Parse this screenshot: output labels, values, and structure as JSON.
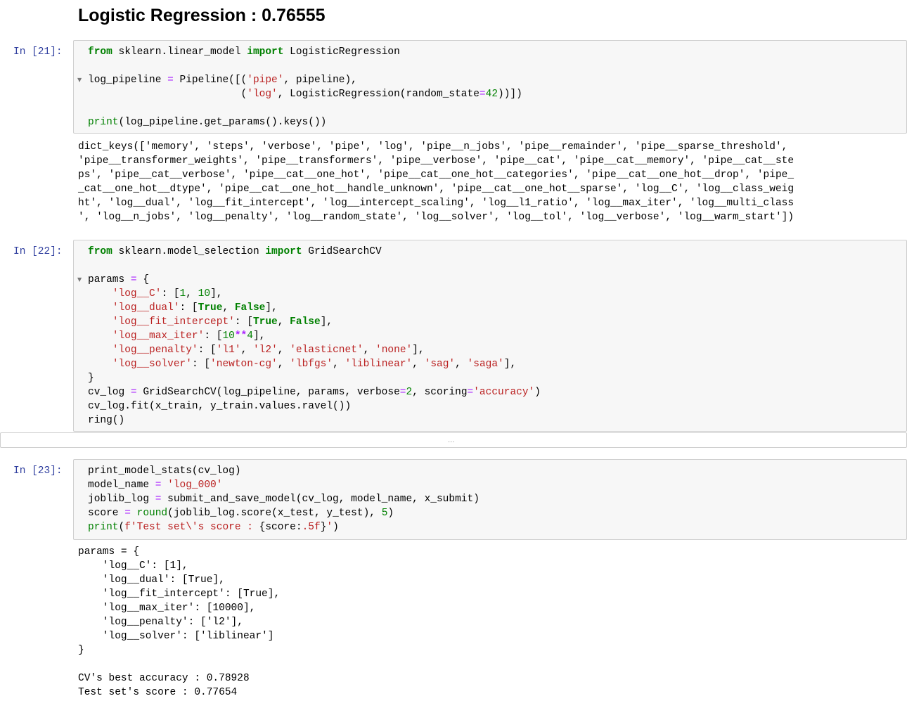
{
  "heading": "Logistic Regression : 0.76555",
  "cells": [
    {
      "prompt": "In [21]:",
      "fold_line": 2,
      "code": [
        [
          [
            "kw",
            "from"
          ],
          [
            "t",
            " sklearn.linear_model "
          ],
          [
            "kw",
            "import"
          ],
          [
            "t",
            " LogisticRegression"
          ]
        ],
        [],
        [
          [
            "t",
            "log_pipeline "
          ],
          [
            "eq",
            "="
          ],
          [
            "t",
            " Pipeline([("
          ],
          [
            "str",
            "'pipe'"
          ],
          [
            "t",
            ", pipeline),"
          ]
        ],
        [
          [
            "t",
            "                         ("
          ],
          [
            "str",
            "'log'"
          ],
          [
            "t",
            ", LogisticRegression(random_state"
          ],
          [
            "eq",
            "="
          ],
          [
            "num",
            "42"
          ],
          [
            "t",
            "))])"
          ]
        ],
        [],
        [
          [
            "bi",
            "print"
          ],
          [
            "t",
            "(log_pipeline.get_params().keys())"
          ]
        ]
      ],
      "output": [
        "dict_keys(['memory', 'steps', 'verbose', 'pipe', 'log', 'pipe__n_jobs', 'pipe__remainder', 'pipe__sparse_threshold',",
        "'pipe__transformer_weights', 'pipe__transformers', 'pipe__verbose', 'pipe__cat', 'pipe__cat__memory', 'pipe__cat__ste",
        "ps', 'pipe__cat__verbose', 'pipe__cat__one_hot', 'pipe__cat__one_hot__categories', 'pipe__cat__one_hot__drop', 'pipe_",
        "_cat__one_hot__dtype', 'pipe__cat__one_hot__handle_unknown', 'pipe__cat__one_hot__sparse', 'log__C', 'log__class_weig",
        "ht', 'log__dual', 'log__fit_intercept', 'log__intercept_scaling', 'log__l1_ratio', 'log__max_iter', 'log__multi_class",
        "', 'log__n_jobs', 'log__penalty', 'log__random_state', 'log__solver', 'log__tol', 'log__verbose', 'log__warm_start'])"
      ]
    },
    {
      "prompt": "In [22]:",
      "fold_line": 2,
      "code": [
        [
          [
            "kw",
            "from"
          ],
          [
            "t",
            " sklearn.model_selection "
          ],
          [
            "kw",
            "import"
          ],
          [
            "t",
            " GridSearchCV"
          ]
        ],
        [],
        [
          [
            "t",
            "params "
          ],
          [
            "eq",
            "="
          ],
          [
            "t",
            " {"
          ]
        ],
        [
          [
            "t",
            "    "
          ],
          [
            "str",
            "'log__C'"
          ],
          [
            "t",
            ": ["
          ],
          [
            "num",
            "1"
          ],
          [
            "t",
            ", "
          ],
          [
            "num",
            "10"
          ],
          [
            "t",
            "],"
          ]
        ],
        [
          [
            "t",
            "    "
          ],
          [
            "str",
            "'log__dual'"
          ],
          [
            "t",
            ": ["
          ],
          [
            "kw",
            "True"
          ],
          [
            "t",
            ", "
          ],
          [
            "kw",
            "False"
          ],
          [
            "t",
            "],"
          ]
        ],
        [
          [
            "t",
            "    "
          ],
          [
            "str",
            "'log__fit_intercept'"
          ],
          [
            "t",
            ": ["
          ],
          [
            "kw",
            "True"
          ],
          [
            "t",
            ", "
          ],
          [
            "kw",
            "False"
          ],
          [
            "t",
            "],"
          ]
        ],
        [
          [
            "t",
            "    "
          ],
          [
            "str",
            "'log__max_iter'"
          ],
          [
            "t",
            ": ["
          ],
          [
            "num",
            "10"
          ],
          [
            "op",
            "**"
          ],
          [
            "num",
            "4"
          ],
          [
            "t",
            "],"
          ]
        ],
        [
          [
            "t",
            "    "
          ],
          [
            "str",
            "'log__penalty'"
          ],
          [
            "t",
            ": ["
          ],
          [
            "str",
            "'l1'"
          ],
          [
            "t",
            ", "
          ],
          [
            "str",
            "'l2'"
          ],
          [
            "t",
            ", "
          ],
          [
            "str",
            "'elasticnet'"
          ],
          [
            "t",
            ", "
          ],
          [
            "str",
            "'none'"
          ],
          [
            "t",
            "],"
          ]
        ],
        [
          [
            "t",
            "    "
          ],
          [
            "str",
            "'log__solver'"
          ],
          [
            "t",
            ": ["
          ],
          [
            "str",
            "'newton-cg'"
          ],
          [
            "t",
            ", "
          ],
          [
            "str",
            "'lbfgs'"
          ],
          [
            "t",
            ", "
          ],
          [
            "str",
            "'liblinear'"
          ],
          [
            "t",
            ", "
          ],
          [
            "str",
            "'sag'"
          ],
          [
            "t",
            ", "
          ],
          [
            "str",
            "'saga'"
          ],
          [
            "t",
            "],"
          ]
        ],
        [
          [
            "t",
            "}"
          ]
        ],
        [
          [
            "t",
            "cv_log "
          ],
          [
            "eq",
            "="
          ],
          [
            "t",
            " GridSearchCV(log_pipeline, params, verbose"
          ],
          [
            "eq",
            "="
          ],
          [
            "num",
            "2"
          ],
          [
            "t",
            ", scoring"
          ],
          [
            "eq",
            "="
          ],
          [
            "str",
            "'accuracy'"
          ],
          [
            "t",
            ")"
          ]
        ],
        [
          [
            "t",
            "cv_log.fit(x_train, y_train.values.ravel())"
          ]
        ],
        [
          [
            "t",
            "ring()"
          ]
        ]
      ],
      "collapsed_output": "..."
    },
    {
      "prompt": "In [23]:",
      "code": [
        [
          [
            "t",
            "print_model_stats(cv_log)"
          ]
        ],
        [
          [
            "t",
            "model_name "
          ],
          [
            "eq",
            "="
          ],
          [
            "t",
            " "
          ],
          [
            "str",
            "'log_000'"
          ]
        ],
        [
          [
            "t",
            "joblib_log "
          ],
          [
            "eq",
            "="
          ],
          [
            "t",
            " submit_and_save_model(cv_log, model_name, x_submit)"
          ]
        ],
        [
          [
            "t",
            "score "
          ],
          [
            "eq",
            "="
          ],
          [
            "t",
            " "
          ],
          [
            "bi",
            "round"
          ],
          [
            "t",
            "(joblib_log.score(x_test, y_test), "
          ],
          [
            "num",
            "5"
          ],
          [
            "t",
            ")"
          ]
        ],
        [
          [
            "bi",
            "print"
          ],
          [
            "t",
            "("
          ],
          [
            "str",
            "f'Test set\\'s score : "
          ],
          [
            "t",
            "{score:"
          ],
          [
            "str",
            ".5f"
          ],
          [
            "t",
            "}"
          ],
          [
            "str",
            "'"
          ],
          [
            "t",
            ")"
          ]
        ]
      ],
      "output": [
        "params = {",
        "    'log__C': [1],",
        "    'log__dual': [True],",
        "    'log__fit_intercept': [True],",
        "    'log__max_iter': [10000],",
        "    'log__penalty': ['l2'],",
        "    'log__solver': ['liblinear']",
        "}",
        "",
        "CV's best accuracy : 0.78928",
        "Test set's score : 0.77654"
      ]
    }
  ]
}
